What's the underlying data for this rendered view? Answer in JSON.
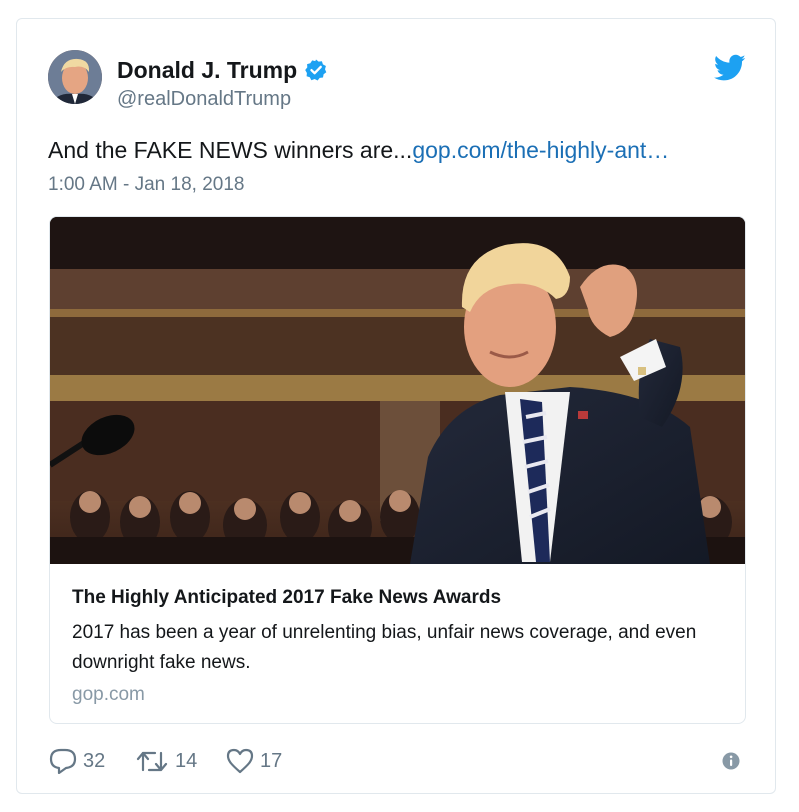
{
  "author": {
    "display_name": "Donald J. Trump",
    "handle": "@realDonaldTrump",
    "verified": true,
    "avatar_icon": "profile-photo",
    "verified_icon": "verified-badge-icon"
  },
  "brand": {
    "icon": "twitter-bird-icon",
    "color": "#1da1f2"
  },
  "tweet": {
    "text": "And the FAKE NEWS winners are...",
    "link_text": "gop.com/the-highly-ant…",
    "timestamp": "1:00 AM - Jan 18, 2018",
    "link_color": "#1b6fb5"
  },
  "link_card": {
    "image_icon": "card-photo",
    "title": "The Highly Anticipated 2017 Fake News Awards",
    "description": "2017 has been a year of unrelenting bias, unfair news coverage, and even downright fake news.",
    "domain": "gop.com"
  },
  "actions": {
    "reply": {
      "icon": "reply-icon",
      "count": "32"
    },
    "retweet": {
      "icon": "retweet-icon",
      "count": "14"
    },
    "like": {
      "icon": "heart-icon",
      "count": "17"
    },
    "info": {
      "icon": "info-icon"
    }
  }
}
